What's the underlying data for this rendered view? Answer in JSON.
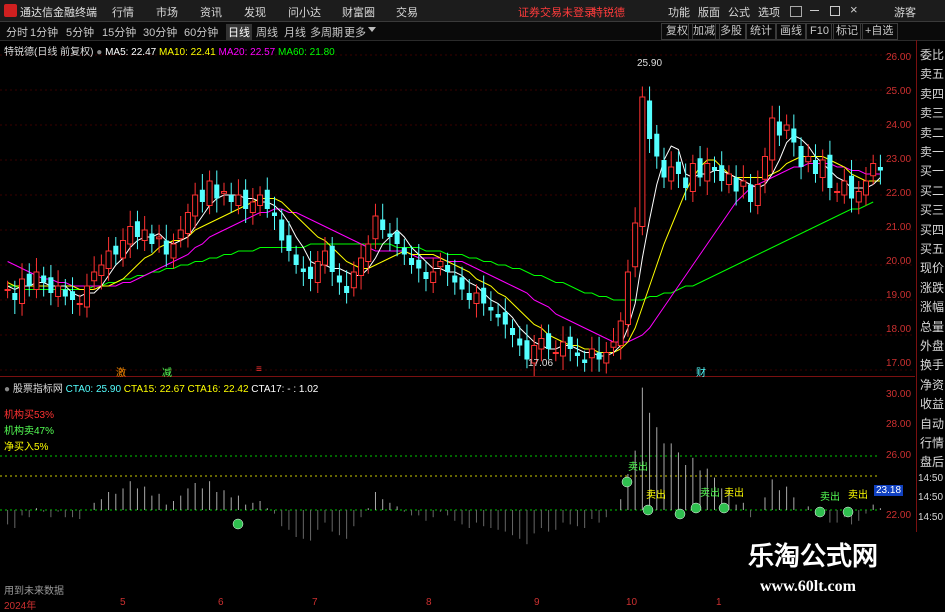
{
  "app": {
    "name": "通达信金融终端",
    "warning": "证券交易未登录",
    "stock": "特锐德",
    "guest": "游客"
  },
  "menu": [
    "行情",
    "市场",
    "资讯",
    "发现",
    "问小达",
    "财富圈",
    "交易"
  ],
  "right_menu": [
    "功能",
    "版面",
    "公式",
    "选项"
  ],
  "periods": [
    "分时",
    "1分钟",
    "5分钟",
    "15分钟",
    "30分钟",
    "60分钟",
    "日线",
    "周线",
    "月线",
    "多周期",
    "更多"
  ],
  "active_period": "日线",
  "tools": [
    "复权",
    "加减",
    "多股",
    "统计",
    "画线",
    "F10",
    "标记",
    "+自选"
  ],
  "main_legend": {
    "title": "特锐德(日线 前复权)",
    "ma5": "MA5: 22.47",
    "ma10": "MA10: 22.41",
    "ma20": "MA20: 22.57",
    "ma60": "MA60: 21.80"
  },
  "sub_legend": {
    "title": "股票指标网",
    "cta0": "CTA0: 25.90",
    "cta15": "CTA15: 22.67",
    "cta16": "CTA16: 22.42",
    "cta17": "CTA17: - : 1.02"
  },
  "sub_labels": {
    "buy": "机构买53%",
    "sell": "机构卖47%",
    "net": "净买入5%"
  },
  "price_labels": {
    "high": "25.90",
    "low": "17.06"
  },
  "event_marks": [
    "激",
    "减",
    "≡",
    "财"
  ],
  "signal_labels": [
    "卖出",
    "卖出",
    "卖出",
    "卖出",
    "卖出",
    "卖出"
  ],
  "ytick_main": [
    "26.00",
    "25.00",
    "24.00",
    "23.00",
    "22.00",
    "21.00",
    "20.00",
    "19.00",
    "18.00",
    "17.00"
  ],
  "ytick_sub": [
    "30.00",
    "28.00",
    "26.00",
    "22.00"
  ],
  "sub_value_box": "23.18",
  "sidebar_items": [
    "委比",
    "卖五",
    "卖四",
    "卖三",
    "卖二",
    "卖一",
    "买一",
    "买二",
    "买三",
    "买四",
    "买五",
    "现价",
    "涨跌",
    "涨幅",
    "总量",
    "外盘",
    "换手",
    "净资",
    "收益",
    "自动",
    "行情",
    "盘后",
    "14:50",
    "14:50",
    "14:50",
    "14:50",
    "14:50"
  ],
  "x_ticks": [
    "2024年",
    "5",
    "6",
    "7",
    "8",
    "9",
    "10",
    "1"
  ],
  "footer": "用到未来数据",
  "watermark": {
    "title": "乐淘公式网",
    "url": "www.60lt.com"
  },
  "colors": {
    "up": "#ff3232",
    "down": "#54ffff",
    "ma5": "#ffffff",
    "ma10": "#ffff00",
    "ma20": "#ff00ff",
    "ma60": "#00ff00"
  },
  "chart_data": {
    "type": "candlestick",
    "ylim": [
      17.0,
      26.0
    ],
    "closes": [
      19.3,
      19.0,
      19.6,
      19.4,
      19.8,
      19.5,
      19.2,
      19.4,
      19.1,
      19.0,
      18.9,
      19.4,
      19.8,
      20.0,
      20.4,
      20.3,
      20.7,
      21.1,
      20.8,
      21.0,
      20.6,
      20.8,
      20.3,
      20.6,
      21.0,
      21.5,
      22.0,
      21.8,
      22.4,
      21.9,
      22.1,
      21.8,
      22.0,
      21.6,
      21.8,
      22.0,
      21.6,
      21.4,
      20.7,
      20.4,
      20.0,
      19.8,
      19.6,
      20.1,
      20.4,
      19.8,
      19.5,
      19.2,
      19.8,
      20.2,
      20.6,
      21.4,
      21.0,
      20.8,
      20.6,
      20.3,
      20.0,
      19.9,
      19.6,
      19.8,
      20.1,
      19.8,
      19.5,
      19.3,
      19.0,
      19.2,
      18.9,
      18.7,
      18.5,
      18.3,
      18.0,
      17.7,
      17.3,
      17.7,
      17.9,
      17.6,
      17.5,
      17.8,
      17.6,
      17.4,
      17.2,
      17.6,
      17.3,
      17.5,
      17.8,
      18.4,
      19.8,
      21.2,
      24.8,
      23.6,
      23.1,
      22.5,
      22.8,
      22.6,
      22.2,
      22.9,
      22.5,
      22.9,
      22.7,
      22.4,
      22.6,
      22.1,
      22.4,
      21.8,
      22.3,
      23.1,
      24.2,
      23.7,
      24.0,
      23.5,
      22.8,
      23.1,
      22.6,
      23.0,
      22.2,
      22.1,
      22.4,
      21.9,
      22.1,
      22.4,
      22.9,
      22.7
    ],
    "ma5": [
      19.4,
      19.3,
      19.4,
      19.4,
      19.5,
      19.5,
      19.4,
      19.4,
      19.4,
      19.2,
      19.1,
      19.2,
      19.2,
      19.4,
      19.7,
      20.0,
      20.2,
      20.5,
      20.7,
      20.8,
      20.8,
      20.9,
      20.7,
      20.6,
      20.7,
      20.8,
      21.1,
      21.4,
      21.7,
      21.9,
      22.0,
      22.0,
      22.0,
      21.9,
      21.9,
      21.8,
      21.8,
      21.7,
      21.5,
      21.2,
      20.8,
      20.5,
      20.1,
      20.0,
      20.0,
      19.9,
      19.9,
      19.8,
      19.7,
      19.7,
      19.9,
      20.2,
      20.6,
      20.8,
      21.0,
      20.8,
      20.5,
      20.3,
      20.1,
      19.9,
      19.9,
      19.8,
      19.8,
      19.7,
      19.5,
      19.4,
      19.2,
      19.0,
      18.9,
      18.7,
      18.5,
      18.2,
      18.0,
      17.8,
      17.7,
      17.6,
      17.6,
      17.7,
      17.7,
      17.6,
      17.5,
      17.5,
      17.4,
      17.4,
      17.5,
      17.7,
      18.2,
      18.9,
      20.2,
      21.3,
      22.3,
      23.0,
      23.4,
      23.3,
      22.6,
      22.5,
      22.6,
      22.6,
      22.7,
      22.7,
      22.6,
      22.5,
      22.4,
      22.3,
      22.2,
      22.3,
      22.6,
      23.0,
      23.5,
      23.7,
      23.6,
      23.4,
      23.1,
      22.9,
      22.7,
      22.5,
      22.4,
      22.2,
      22.2,
      22.2,
      22.3,
      22.5
    ],
    "ma10": [
      19.5,
      19.4,
      19.4,
      19.4,
      19.4,
      19.4,
      19.4,
      19.4,
      19.4,
      19.4,
      19.3,
      19.3,
      19.3,
      19.4,
      19.4,
      19.5,
      19.6,
      19.8,
      20.0,
      20.2,
      20.3,
      20.5,
      20.6,
      20.7,
      20.7,
      20.8,
      21.0,
      21.1,
      21.2,
      21.3,
      21.4,
      21.5,
      21.6,
      21.7,
      21.8,
      21.9,
      21.9,
      21.9,
      21.8,
      21.6,
      21.4,
      21.2,
      21.0,
      20.8,
      20.7,
      20.5,
      20.3,
      20.1,
      20.0,
      19.9,
      19.9,
      20.0,
      20.1,
      20.2,
      20.3,
      20.4,
      20.3,
      20.3,
      20.3,
      20.3,
      20.2,
      20.1,
      20.0,
      19.9,
      19.8,
      19.6,
      19.5,
      19.4,
      19.2,
      19.1,
      18.9,
      18.7,
      18.5,
      18.3,
      18.2,
      18.0,
      17.9,
      17.8,
      17.7,
      17.7,
      17.6,
      17.6,
      17.5,
      17.5,
      17.5,
      17.6,
      17.8,
      18.2,
      18.8,
      19.4,
      20.0,
      20.6,
      21.1,
      21.6,
      22.1,
      22.5,
      22.8,
      23.0,
      23.0,
      22.8,
      22.6,
      22.5,
      22.5,
      22.5,
      22.5,
      22.5,
      22.6,
      22.7,
      22.9,
      23.0,
      23.1,
      23.1,
      23.1,
      23.1,
      23.0,
      22.9,
      22.8,
      22.6,
      22.5,
      22.4,
      22.4,
      22.4
    ],
    "ma20": [
      20.1,
      20.0,
      19.9,
      19.8,
      19.7,
      19.6,
      19.6,
      19.5,
      19.5,
      19.4,
      19.4,
      19.4,
      19.4,
      19.4,
      19.4,
      19.4,
      19.5,
      19.5,
      19.6,
      19.7,
      19.8,
      19.9,
      20.0,
      20.1,
      20.2,
      20.3,
      20.5,
      20.6,
      20.8,
      20.9,
      21.0,
      21.1,
      21.2,
      21.3,
      21.4,
      21.5,
      21.5,
      21.6,
      21.6,
      21.5,
      21.5,
      21.4,
      21.3,
      21.2,
      21.1,
      21.0,
      20.9,
      20.8,
      20.7,
      20.6,
      20.5,
      20.4,
      20.4,
      20.4,
      20.4,
      20.4,
      20.3,
      20.2,
      20.2,
      20.2,
      20.2,
      20.1,
      20.1,
      20.1,
      20.0,
      19.9,
      19.8,
      19.7,
      19.6,
      19.5,
      19.4,
      19.3,
      19.2,
      19.0,
      18.9,
      18.8,
      18.6,
      18.5,
      18.4,
      18.3,
      18.2,
      18.1,
      18.0,
      17.9,
      17.8,
      17.8,
      17.8,
      17.9,
      18.0,
      18.2,
      18.5,
      18.8,
      19.1,
      19.4,
      19.7,
      20.0,
      20.3,
      20.6,
      20.9,
      21.2,
      21.5,
      21.8,
      22.0,
      22.2,
      22.3,
      22.4,
      22.5,
      22.6,
      22.7,
      22.8,
      22.8,
      22.9,
      22.9,
      22.9,
      22.9,
      22.8,
      22.8,
      22.7,
      22.7,
      22.6,
      22.6,
      22.6
    ],
    "ma60": [
      19.4,
      19.4,
      19.3,
      19.3,
      19.3,
      19.3,
      19.3,
      19.3,
      19.3,
      19.3,
      19.3,
      19.3,
      19.4,
      19.4,
      19.5,
      19.5,
      19.6,
      19.6,
      19.7,
      19.7,
      19.8,
      19.8,
      19.9,
      19.9,
      20.0,
      20.0,
      20.1,
      20.1,
      20.2,
      20.2,
      20.3,
      20.3,
      20.4,
      20.4,
      20.4,
      20.5,
      20.5,
      20.5,
      20.5,
      20.5,
      20.5,
      20.5,
      20.6,
      20.6,
      20.6,
      20.6,
      20.6,
      20.6,
      20.6,
      20.6,
      20.6,
      20.6,
      20.6,
      20.6,
      20.5,
      20.5,
      20.5,
      20.5,
      20.4,
      20.4,
      20.4,
      20.3,
      20.3,
      20.3,
      20.2,
      20.2,
      20.1,
      20.1,
      20.0,
      20.0,
      19.9,
      19.9,
      19.8,
      19.7,
      19.7,
      19.6,
      19.5,
      19.5,
      19.4,
      19.3,
      19.2,
      19.2,
      19.1,
      19.1,
      19.0,
      19.0,
      19.0,
      19.0,
      19.0,
      19.1,
      19.1,
      19.2,
      19.2,
      19.3,
      19.4,
      19.4,
      19.5,
      19.6,
      19.7,
      19.8,
      19.9,
      20.0,
      20.1,
      20.2,
      20.3,
      20.4,
      20.5,
      20.6,
      20.7,
      20.8,
      20.9,
      21.0,
      21.1,
      21.2,
      21.3,
      21.4,
      21.5,
      21.6,
      21.6,
      21.7,
      21.8
    ]
  }
}
